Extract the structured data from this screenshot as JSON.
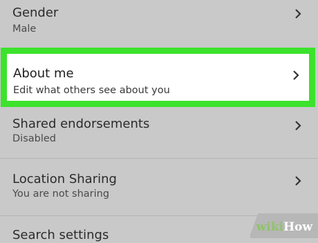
{
  "settings": {
    "items": [
      {
        "title": "Gender",
        "subtitle": "Male"
      },
      {
        "title": "About me",
        "subtitle": "Edit what others see about you"
      },
      {
        "title": "Shared endorsements",
        "subtitle": "Disabled"
      },
      {
        "title": "Location Sharing",
        "subtitle": "You are not sharing"
      },
      {
        "title": "Search settings",
        "subtitle": ""
      }
    ]
  },
  "watermark": {
    "part1": "wiki",
    "part2": "How"
  },
  "colors": {
    "background": "#c9c9c9",
    "highlight_border": "#3ce22c",
    "highlight_fill": "#ffffff",
    "text": "#2b2b2b"
  }
}
